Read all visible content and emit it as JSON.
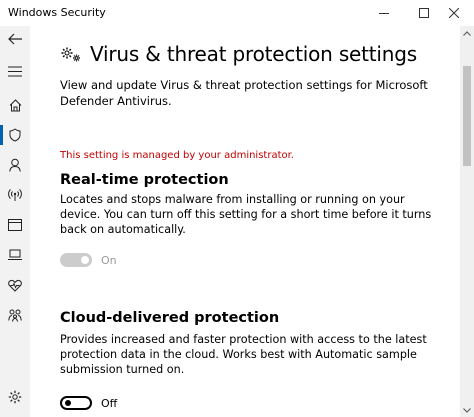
{
  "window": {
    "title": "Windows Security"
  },
  "sidebar": {
    "items": [
      {
        "icon": "home-icon"
      },
      {
        "icon": "shield-icon",
        "active": true
      },
      {
        "icon": "person-icon"
      },
      {
        "icon": "wireless-icon"
      },
      {
        "icon": "app-browser-icon"
      },
      {
        "icon": "laptop-icon"
      },
      {
        "icon": "heart-icon"
      },
      {
        "icon": "family-icon"
      }
    ],
    "bottom_icon": "gear-icon"
  },
  "page": {
    "title": "Virus & threat protection settings",
    "description": "View and update Virus & threat protection settings for Microsoft Defender Antivirus.",
    "admin_message": "This setting is managed by your administrator."
  },
  "realtime": {
    "title": "Real-time protection",
    "description": "Locates and stops malware from installing or running on your device. You can turn off this setting for a short time before it turns back on automatically.",
    "state_label": "On"
  },
  "cloud": {
    "title": "Cloud-delivered protection",
    "description": "Provides increased and faster protection with access to the latest protection data in the cloud. Works best with Automatic sample submission turned on.",
    "state_label": "Off"
  },
  "colors": {
    "accent": "#0063b1",
    "admin_text": "#c00000",
    "disabled": "#cccccc"
  }
}
